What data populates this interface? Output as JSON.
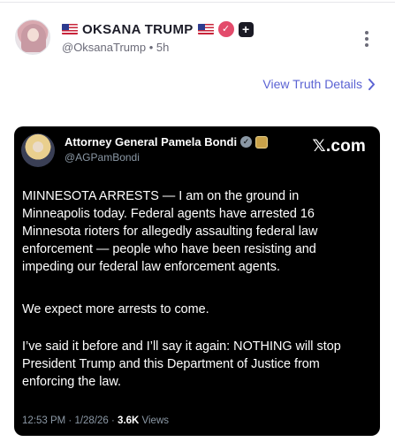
{
  "post": {
    "display_name": "OKSANA TRUMP",
    "handle": "@OksanaTrump",
    "time": "5h",
    "separator": "•",
    "view_details": "View Truth Details",
    "icons": {
      "flag": "us-flag-icon",
      "verified": "verified-badge-icon",
      "plus": "plus-badge-icon",
      "more": "more-vertical-icon",
      "chevron": "chevron-right-icon"
    },
    "colors": {
      "accent": "#5b63d3",
      "verified_badge": "#e34b6b",
      "card_background": "#000000"
    }
  },
  "embedded": {
    "name": "Attorney General Pamela Bondi",
    "handle": "@AGPamBondi",
    "brand": "𝕏.com",
    "paragraphs": [
      "MINNESOTA ARRESTS — I am on the ground in Minneapolis today. Federal agents have arrested 16 Minnesota rioters for allegedly assaulting federal law enforcement — people who have been resisting and impeding our federal law enforcement agents.",
      "We expect more arrests to come.",
      "I’ve said it before and I’ll say it again: NOTHING will stop President Trump and this Department of Justice from enforcing the law."
    ],
    "time_date": "12:53 PM · 1/28/26 · ",
    "views_count": "3.6K",
    "views_label": " Views"
  }
}
